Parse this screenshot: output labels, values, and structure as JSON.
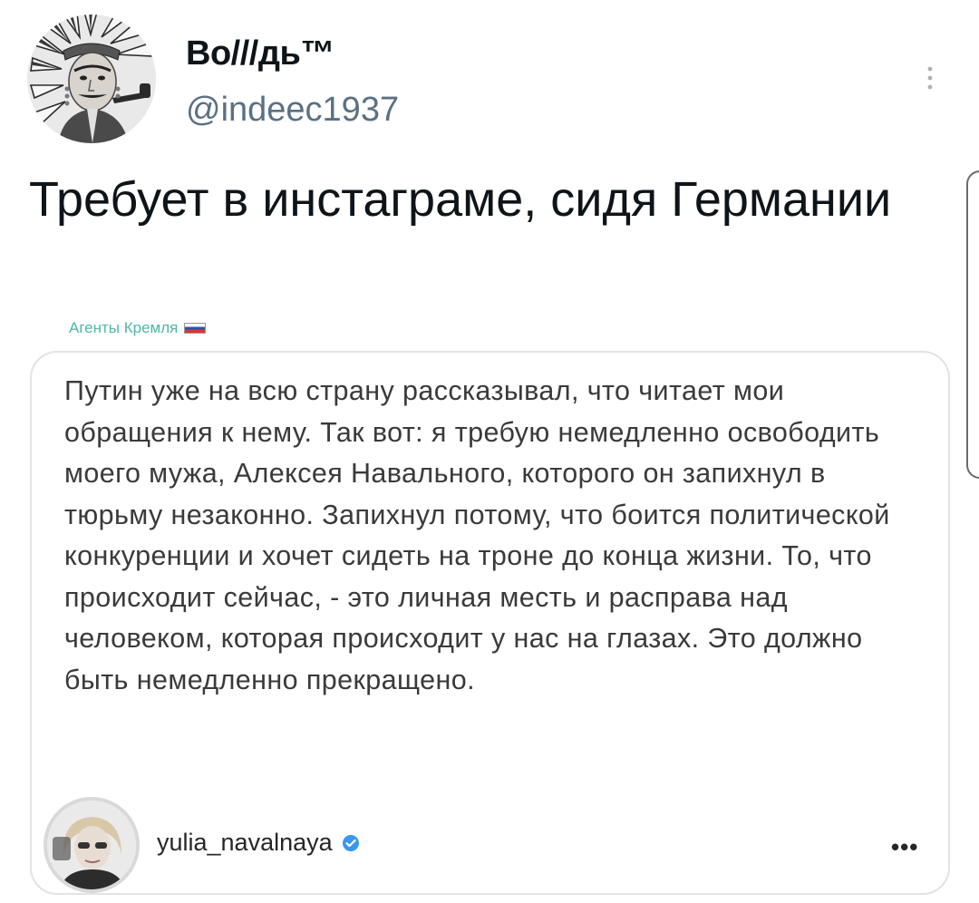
{
  "tweet": {
    "author_name": "Во///дь™",
    "author_handle": "@indeec1937",
    "text": "Требует в инстаграме, сидя Германии",
    "menu_icon": "more-vertical-icon"
  },
  "embedded_image": {
    "source_label": "Агенты Кремля",
    "source_flag_icon": "russia-flag-icon",
    "post_text": "Путин уже на всю страну рассказывал, что читает мои обращения к нему. Так вот: я требую немедленно освободить моего мужа, Алексея Навального, которого он запихнул в тюрьму незаконно. Запихнул потому, что боится политической конкуренции и хочет сидеть на троне до конца жизни. То, что происходит сейчас, - это личная месть и расправа над человеком, которая происходит у нас на глазах. Это должно быть немедленно прекращено.",
    "post_author": "yulia_navalnaya",
    "verified_icon": "verified-badge-icon",
    "post_menu_icon": "more-horizontal-icon",
    "post_menu_glyph": "•••",
    "colors": {
      "source_label": "#4fb7a6",
      "verified": "#3897f0"
    }
  }
}
